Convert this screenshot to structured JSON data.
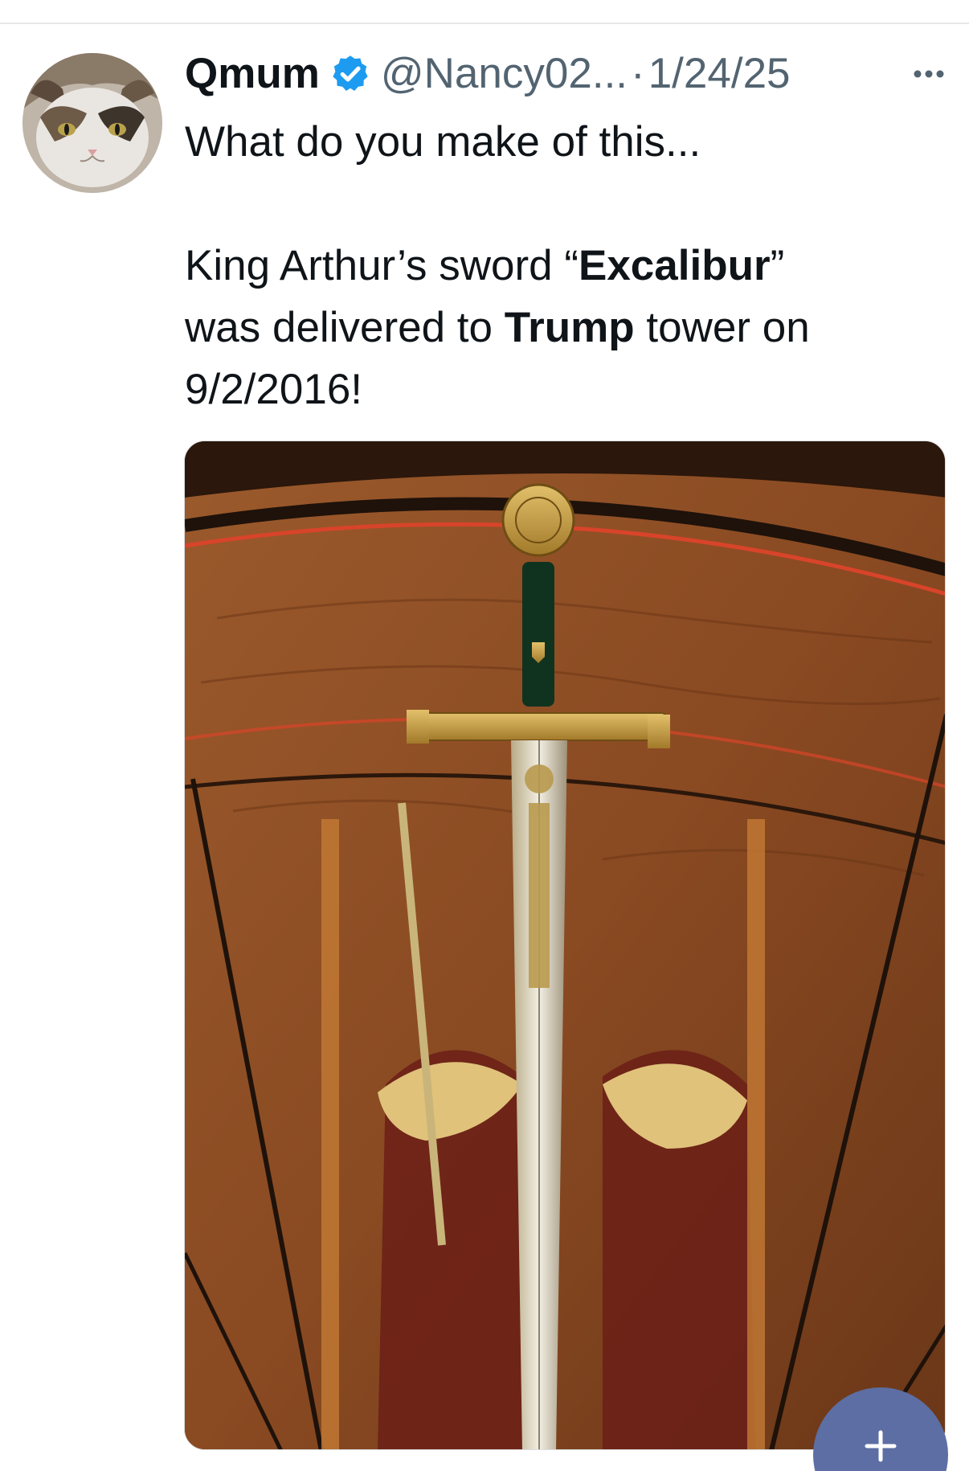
{
  "post": {
    "display_name": "Qmum",
    "handle": "@Nancy02...",
    "separator": "·",
    "timestamp": "1/24/25",
    "text_line1": "What do you make of this...",
    "text_p2_a": "King Arthur’s sword “",
    "text_p2_b": "Excalibur",
    "text_p2_c": "”",
    "text_p2_d": "was delivered to ",
    "text_p2_e": "Trump",
    "text_p2_f": " tower on",
    "text_p2_g": "9/2/2016!"
  },
  "icons": {
    "verified": "verified-badge-icon",
    "more": "more-horizontal-icon",
    "compose": "plus-icon"
  },
  "colors": {
    "accent_blue": "#1d9bf0",
    "muted_text": "#536471",
    "fab": "#5c6ea3"
  }
}
